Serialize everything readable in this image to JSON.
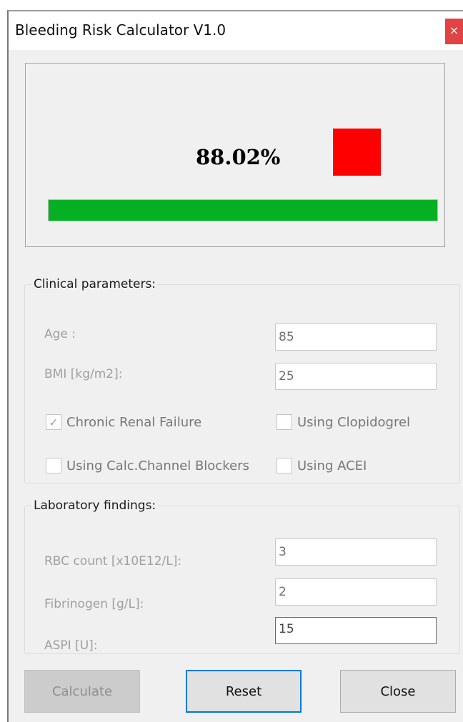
{
  "window": {
    "title": "Bleeding Risk Calculator V1.0",
    "close_glyph": "×"
  },
  "result": {
    "percent_text": "88.02%",
    "indicator_color": "#ff0000",
    "progress_fraction": 1.0,
    "progress_color": "#06b025"
  },
  "clinical": {
    "legend": "Clinical parameters:",
    "age_label": "Age :",
    "age_value": "85",
    "bmi_label": "BMI [kg/m2]:",
    "bmi_value": "25",
    "checkboxes": {
      "crf": {
        "label": "Chronic Renal Failure",
        "checked": true
      },
      "clopidogrel": {
        "label": "Using Clopidogrel",
        "checked": false
      },
      "ccb": {
        "label": "Using Calc.Channel Blockers",
        "checked": false
      },
      "acei": {
        "label": "Using ACEI",
        "checked": false
      }
    },
    "check_glyph": "✓"
  },
  "lab": {
    "legend": "Laboratory findings:",
    "rbc_label": "RBC count [x10E12/L]:",
    "rbc_value": "3",
    "fibrinogen_label": "Fibrinogen [g/L]:",
    "fibrinogen_value": "2",
    "aspi_label": "ASPI [U]:",
    "aspi_value": "15"
  },
  "buttons": {
    "calculate": "Calculate",
    "reset": "Reset",
    "close": "Close"
  }
}
